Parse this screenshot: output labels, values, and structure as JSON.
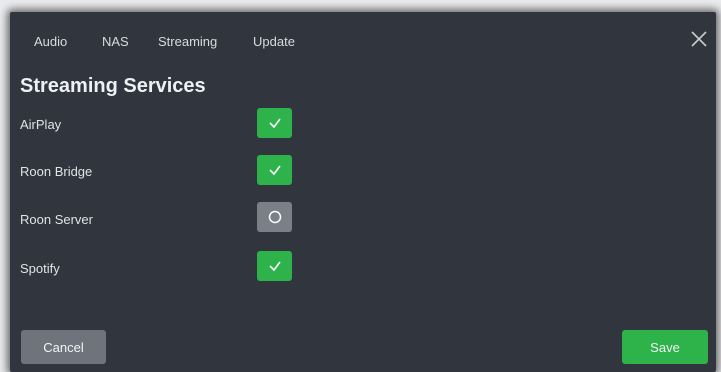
{
  "tabs": [
    {
      "label": "Audio"
    },
    {
      "label": "NAS"
    },
    {
      "label": "Streaming"
    },
    {
      "label": "Update"
    }
  ],
  "section_title": "Streaming Services",
  "services": [
    {
      "label": "AirPlay",
      "enabled": true
    },
    {
      "label": "Roon Bridge",
      "enabled": true
    },
    {
      "label": "Roon Server",
      "enabled": false
    },
    {
      "label": "Spotify",
      "enabled": true
    }
  ],
  "buttons": {
    "cancel_label": "Cancel",
    "save_label": "Save"
  },
  "colors": {
    "dialog_bg": "#31353d",
    "accent_green": "#2db34a",
    "toggle_off": "#7a7f88",
    "cancel_bg": "#6f747c"
  },
  "icons": {
    "close": "close-icon",
    "enabled": "check-icon",
    "disabled": "circle-icon"
  }
}
